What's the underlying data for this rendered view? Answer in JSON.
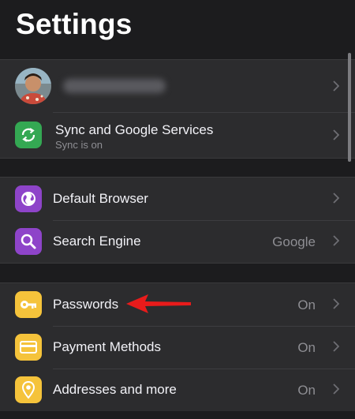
{
  "header": {
    "title": "Settings"
  },
  "account": {
    "sync": {
      "label": "Sync and Google Services",
      "sublabel": "Sync is on"
    }
  },
  "browser_group": {
    "items": [
      {
        "label": "Default Browser",
        "value": ""
      },
      {
        "label": "Search Engine",
        "value": "Google"
      }
    ]
  },
  "autofill_group": {
    "items": [
      {
        "label": "Passwords",
        "value": "On"
      },
      {
        "label": "Payment Methods",
        "value": "On"
      },
      {
        "label": "Addresses and more",
        "value": "On"
      }
    ]
  },
  "icons": {
    "sync": "sync-icon",
    "default_browser": "globe-icon",
    "search_engine": "search-icon",
    "passwords": "key-icon",
    "payment_methods": "credit-card-icon",
    "addresses": "location-pin-icon",
    "chevron": "chevron-right-icon",
    "annotation": "red-arrow-icon"
  },
  "colors": {
    "background": "#1c1c1e",
    "group_background": "#2c2c2e",
    "sync_green": "#34a853",
    "purple": "#8e44c9",
    "yellow": "#f5c33b",
    "annotation_red": "#e81b1b",
    "secondary_text": "#8e8e93"
  }
}
